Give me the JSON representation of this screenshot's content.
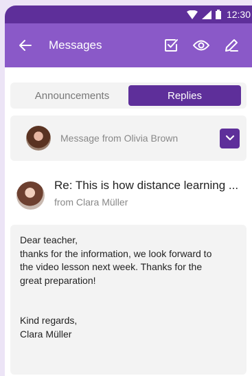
{
  "status_bar": {
    "time": "12:30"
  },
  "app_bar": {
    "title": "Messages"
  },
  "tabs": [
    {
      "label": "Announcements",
      "active": false
    },
    {
      "label": "Replies",
      "active": true
    }
  ],
  "sender_select": {
    "label": "Message from Olivia Brown"
  },
  "message": {
    "subject": "Re: This is how distance learning ...",
    "from": "from Clara Müller",
    "body_greeting": "Dear teacher,",
    "body_line1": "thanks for the information, we look forward to",
    "body_line2": "the video lesson next week. Thanks for the",
    "body_line3": "great preparation!",
    "closing": "Kind regards,",
    "signature": "Clara Müller"
  },
  "colors": {
    "accent_dark": "#5e2f9a",
    "app_bar": "#8a59c8",
    "background": "#ece4f6"
  },
  "icons": {
    "back": "arrow-left-icon",
    "check": "checkbox-icon",
    "eye": "eye-icon",
    "edit": "pencil-icon",
    "dropdown": "chevron-down-icon"
  }
}
